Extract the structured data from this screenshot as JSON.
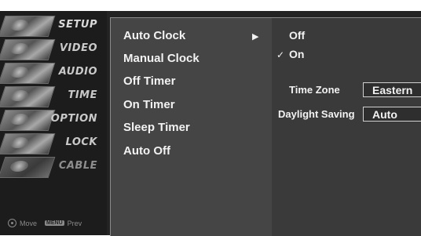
{
  "left_menu": {
    "items": [
      {
        "label": "SETUP",
        "icon": "setup-icon",
        "state": "active"
      },
      {
        "label": "VIDEO",
        "icon": "video-icon",
        "state": "normal"
      },
      {
        "label": "AUDIO",
        "icon": "audio-icon",
        "state": "normal"
      },
      {
        "label": "TIME",
        "icon": "time-icon",
        "state": "normal"
      },
      {
        "label": "OPTION",
        "icon": "option-icon",
        "state": "normal"
      },
      {
        "label": "LOCK",
        "icon": "lock-icon",
        "state": "normal"
      },
      {
        "label": "CABLE",
        "icon": "cable-icon",
        "state": "dim"
      }
    ],
    "hint_move": "Move",
    "hint_menu_key": "MENU",
    "hint_prev": "Prev"
  },
  "time_menu": {
    "items": [
      {
        "label": "Auto Clock",
        "selected": true
      },
      {
        "label": "Manual Clock"
      },
      {
        "label": "Off Timer"
      },
      {
        "label": "On Timer"
      },
      {
        "label": "Sleep Timer"
      },
      {
        "label": "Auto Off"
      }
    ],
    "arrow": "▶"
  },
  "auto_clock": {
    "options": [
      {
        "label": "Off",
        "checked": false
      },
      {
        "label": "On",
        "checked": true
      }
    ],
    "check_mark": "✓",
    "time_zone_label": "Time Zone",
    "time_zone_value": "Eastern",
    "daylight_saving_label": "Daylight Saving",
    "daylight_saving_value": "Auto"
  },
  "colors": {
    "background": "#232323",
    "panel": "#454545",
    "text": "#f2f2f2"
  }
}
